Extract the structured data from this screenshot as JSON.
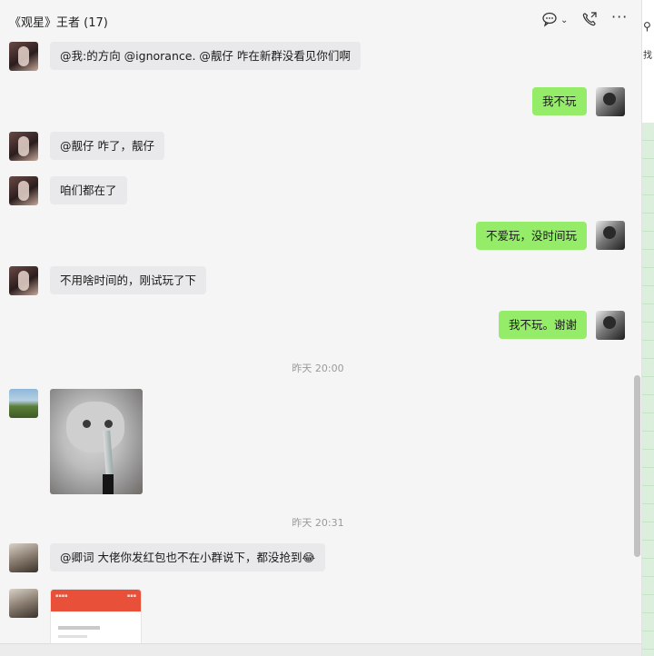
{
  "chat": {
    "title": "《观星》王者 (17)",
    "icons": {
      "chat": "chat-bubble-icon",
      "call": "phone-call-icon",
      "more": "more-dots-icon"
    }
  },
  "messages": [
    {
      "side": "in",
      "text": "@我:的方向  @ignorance.  @靓仔 咋在新群没看见你们啊"
    },
    {
      "side": "out",
      "text": "我不玩"
    },
    {
      "side": "in",
      "text": "@靓仔 咋了，靓仔"
    },
    {
      "side": "in",
      "text": "咱们都在了"
    },
    {
      "side": "out",
      "text": "不爱玩，没时间玩"
    },
    {
      "side": "in",
      "text": "不用啥时间的，刚试玩了下"
    },
    {
      "side": "out",
      "text": "我不玩。谢谢"
    },
    {
      "side": "in",
      "text": "@卿词 大佬你发红包也不在小群说下，都没抢到😂"
    }
  ],
  "timestamps": [
    "昨天 20:00",
    "昨天 20:31"
  ],
  "background_window": {
    "find_label": "找"
  }
}
